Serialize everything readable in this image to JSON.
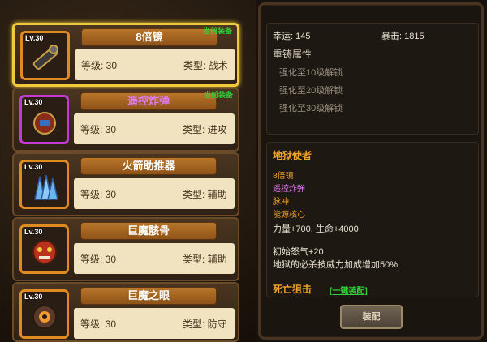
{
  "items": [
    {
      "level": "Lv.30",
      "name": "8倍镜",
      "name_color": "#ffffff",
      "level_text": "等级: 30",
      "type_text": "类型: 战术",
      "equipped": "当前装备",
      "icon": "scope-icon"
    },
    {
      "level": "Lv.30",
      "name": "遥控炸弹",
      "name_color": "#e07af0",
      "level_text": "等级: 30",
      "type_text": "类型: 进攻",
      "equipped": "当前装备",
      "icon": "bomb-icon"
    },
    {
      "level": "Lv.30",
      "name": "火箭助推器",
      "name_color": "#ffffff",
      "level_text": "等级: 30",
      "type_text": "类型: 辅助",
      "equipped": "",
      "icon": "rocket-booster-icon"
    },
    {
      "level": "Lv.30",
      "name": "巨魔骸骨",
      "name_color": "#ffffff",
      "level_text": "等级: 30",
      "type_text": "类型: 辅助",
      "equipped": "",
      "icon": "troll-skull-icon"
    },
    {
      "level": "Lv.30",
      "name": "巨魔之眼",
      "name_color": "#ffffff",
      "level_text": "等级: 30",
      "type_text": "类型: 防守",
      "equipped": "",
      "icon": "troll-eye-icon"
    }
  ],
  "stats": {
    "luck": "幸运:  145",
    "crit": "暴击:  1815",
    "reforge_title": "重铸属性",
    "unlocks": [
      "强化至10级解锁",
      "强化至20级解锁",
      "强化至30级解锁"
    ]
  },
  "set1": {
    "title": "地狱使者",
    "members": [
      {
        "text": "8倍镜",
        "color": "#f0a42a"
      },
      {
        "text": "遥控炸弹",
        "color": "#e07af0"
      },
      {
        "text": "脉冲",
        "color": "#f0a42a"
      },
      {
        "text": "能源核心",
        "color": "#f0a42a"
      }
    ],
    "bonus1": "力量+700, 生命+4000",
    "bonus2": "初始怒气+20",
    "bonus3": "地狱的必杀技威力加成增加50%"
  },
  "set2": {
    "title": "死亡狙击",
    "link": "[一键装配]"
  },
  "equip_button": "装配",
  "colors": {
    "accent": "#f0a42a",
    "selected_border": "#f2c93a",
    "equipped": "#32d13a",
    "link": "#32d13a"
  }
}
